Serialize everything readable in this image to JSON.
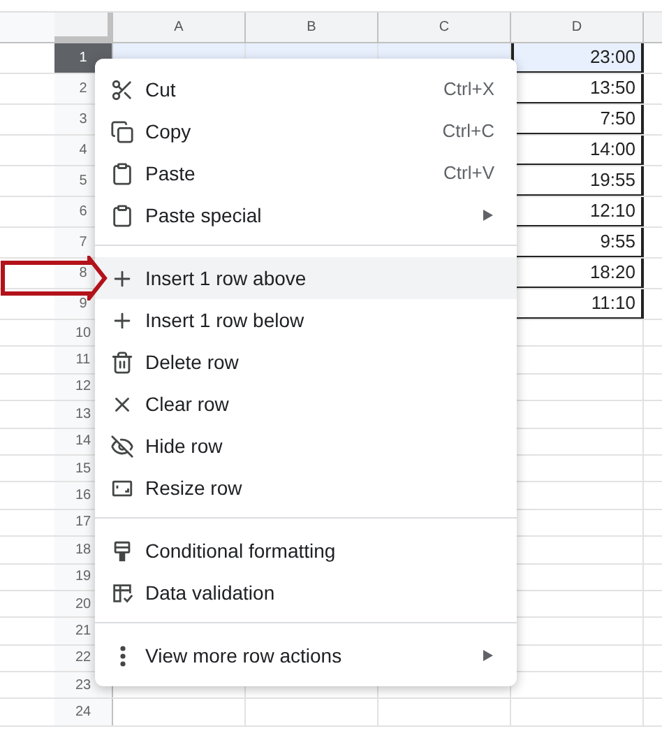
{
  "sheet": {
    "columns": [
      "A",
      "B",
      "C",
      "D"
    ],
    "rows": [
      {
        "number": "1",
        "selected": true,
        "d": "23:00"
      },
      {
        "number": "2",
        "selected": false,
        "d": "13:50"
      },
      {
        "number": "3",
        "selected": false,
        "d": "7:50"
      },
      {
        "number": "4",
        "selected": false,
        "d": "14:00"
      },
      {
        "number": "5",
        "selected": false,
        "d": "19:55"
      },
      {
        "number": "6",
        "selected": false,
        "d": "12:10"
      },
      {
        "number": "7",
        "selected": false,
        "d": "9:55"
      },
      {
        "number": "8",
        "selected": false,
        "d": "18:20"
      },
      {
        "number": "9",
        "selected": false,
        "d": "11:10"
      },
      {
        "number": "10",
        "selected": false
      },
      {
        "number": "11",
        "selected": false
      },
      {
        "number": "12",
        "selected": false
      },
      {
        "number": "13",
        "selected": false
      },
      {
        "number": "14",
        "selected": false
      },
      {
        "number": "15",
        "selected": false
      },
      {
        "number": "16",
        "selected": false
      },
      {
        "number": "17",
        "selected": false
      },
      {
        "number": "18",
        "selected": false
      },
      {
        "number": "19",
        "selected": false
      },
      {
        "number": "20",
        "selected": false
      },
      {
        "number": "21",
        "selected": false
      },
      {
        "number": "22",
        "selected": false
      },
      {
        "number": "23",
        "selected": false
      },
      {
        "number": "24",
        "selected": false
      }
    ]
  },
  "context_menu": {
    "groups": [
      [
        {
          "kind": "cut",
          "label": "Cut",
          "shortcut": "Ctrl+X",
          "submenu": false,
          "selected": false
        },
        {
          "kind": "copy",
          "label": "Copy",
          "shortcut": "Ctrl+C",
          "submenu": false,
          "selected": false
        },
        {
          "kind": "paste",
          "label": "Paste",
          "shortcut": "Ctrl+V",
          "submenu": false,
          "selected": false
        },
        {
          "kind": "paste",
          "label": "Paste special",
          "submenu": true,
          "selected": false
        }
      ],
      [
        {
          "kind": "plus",
          "label": "Insert 1 row above",
          "submenu": false,
          "selected": true
        },
        {
          "kind": "plus",
          "label": "Insert 1 row below",
          "submenu": false,
          "selected": false
        },
        {
          "kind": "delete",
          "label": "Delete row",
          "submenu": false,
          "selected": false
        },
        {
          "kind": "clear",
          "label": "Clear row",
          "submenu": false,
          "selected": false
        },
        {
          "kind": "hide",
          "label": "Hide row",
          "submenu": false,
          "selected": false
        },
        {
          "kind": "resize",
          "label": "Resize row",
          "submenu": false,
          "selected": false
        }
      ],
      [
        {
          "kind": "format",
          "label": "Conditional formatting",
          "submenu": false,
          "selected": false
        },
        {
          "kind": "validation",
          "label": "Data validation",
          "submenu": false,
          "selected": false
        }
      ],
      [
        {
          "kind": "more",
          "label": "View more row actions",
          "submenu": true,
          "selected": false
        }
      ]
    ]
  }
}
